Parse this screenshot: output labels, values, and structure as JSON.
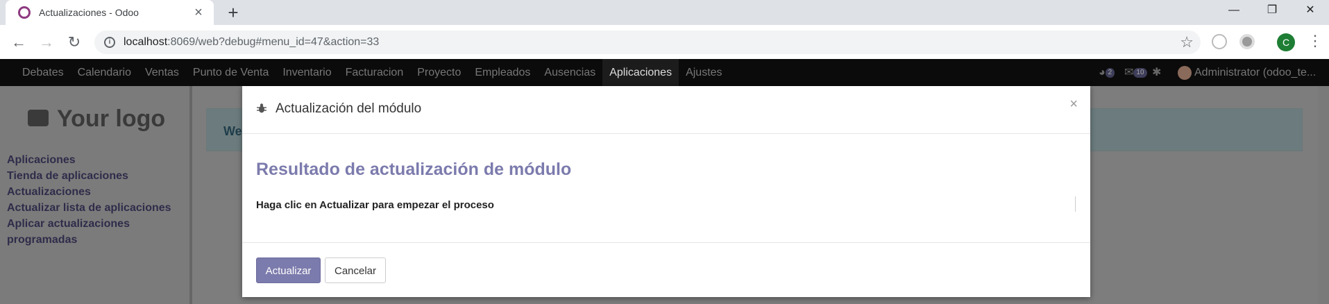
{
  "browser": {
    "tab_title": "Actualizaciones - Odoo",
    "tab_close": "×",
    "new_tab": "+",
    "url_host": "localhost",
    "url_path": ":8069/web?debug#menu_id=47&action=33",
    "profile_initial": "C",
    "window_minimize": "—",
    "window_restore": "❐",
    "window_close": "✕"
  },
  "odoo_nav": {
    "items": [
      "Debates",
      "Calendario",
      "Ventas",
      "Punto de Venta",
      "Inventario",
      "Facturacion",
      "Proyecto",
      "Empleados",
      "Ausencias",
      "Aplicaciones",
      "Ajustes"
    ],
    "active_index": 9,
    "activity_count": "2",
    "messages_count": "10",
    "user": "Administrator (odoo_te..."
  },
  "sidebar": {
    "logo_text": "Your logo",
    "links": [
      "Aplicaciones",
      "Tienda de aplicaciones",
      "Actualizaciones",
      "Actualizar lista de aplicaciones",
      "Aplicar actualizaciones",
      "programadas"
    ]
  },
  "background": {
    "alert_text": "We"
  },
  "modal": {
    "title": "Actualización del módulo",
    "close": "×",
    "result_title": "Resultado de actualización de módulo",
    "description": "Haga clic en Actualizar para empezar el proceso",
    "primary_button": "Actualizar",
    "cancel_button": "Cancelar"
  },
  "colors": {
    "accent": "#7c7bad",
    "nav_bg": "#0b0b0b"
  }
}
